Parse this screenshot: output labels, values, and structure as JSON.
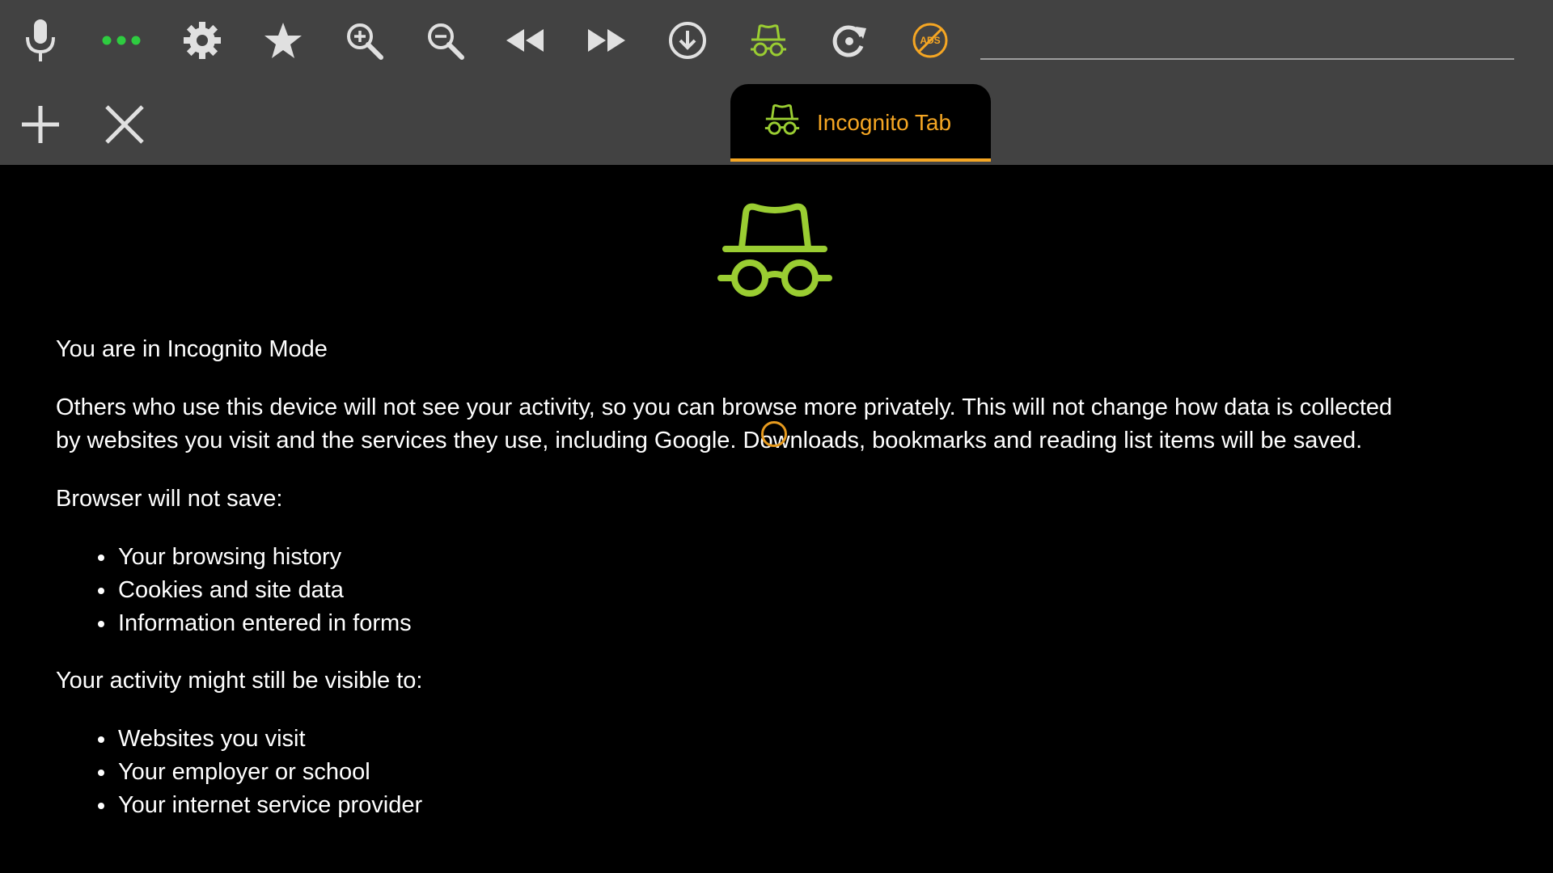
{
  "colors": {
    "toolbar_bg": "#424242",
    "content_bg": "#000000",
    "accent_orange": "#f5a623",
    "incognito_green": "#9acd32",
    "menu_dots_green": "#2ecc40",
    "icon_gray": "#e0e0e0"
  },
  "toolbar": {
    "icons": [
      "microphone-icon",
      "more-dots-icon",
      "gear-icon",
      "star-icon",
      "zoom-in-icon",
      "zoom-out-icon",
      "rewind-icon",
      "fast-forward-icon",
      "download-icon",
      "incognito-icon",
      "reload-icon",
      "ads-blocked-icon"
    ],
    "ads_icon_text": "ADS",
    "url_value": ""
  },
  "tabbar": {
    "icons": [
      "plus-icon",
      "close-icon"
    ],
    "active_tab": {
      "label": "Incognito Tab",
      "icon": "incognito-icon"
    }
  },
  "content": {
    "hero_icon": "incognito-icon",
    "heading": "You are in Incognito Mode",
    "paragraph_line1": "Others who use this device will not see your activity, so you can browse more privately. This will not change how data is collected",
    "paragraph_line2": "by websites you visit and the services they use, including Google. Downloads, bookmarks and reading list items will be saved.",
    "not_save_heading": "Browser will not save:",
    "not_save_items": [
      "Your browsing history",
      "Cookies and site data",
      "Information entered in forms"
    ],
    "visible_heading": "Your activity might still be visible to:",
    "visible_items": [
      "Websites you visit",
      "Your employer or school",
      "Your internet service provider"
    ]
  }
}
